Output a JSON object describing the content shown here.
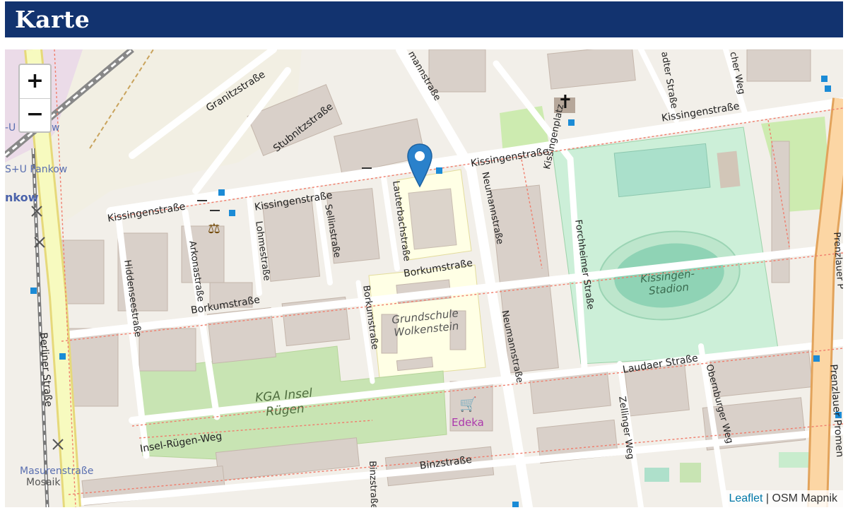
{
  "header": {
    "title": "Karte"
  },
  "map": {
    "zoom_in_label": "+",
    "zoom_out_label": "−",
    "attribution": {
      "link": "Leaflet",
      "separator": " | ",
      "provider": "OSM Mapnik"
    },
    "marker_icon": "map-marker-icon",
    "streets": {
      "granitzstrasse": "Granitzstraße",
      "stubnitzstrasse": "Stubnitzstraße",
      "kissingen_1": "Kissingenstraße",
      "kissingen_2": "Kissingenstraße",
      "kissingen_3": "Kissingenstraße",
      "kissingen_4": "Kissingenstraße",
      "kissingenplatz": "Kissingenplatz",
      "sellinstrasse": "Sellinstraße",
      "lauterbachstrasse": "Lauterbachstraße",
      "lohmestrasse": "Lohmestraße",
      "arkonastrasse": "Arkonastraße",
      "hiddenseestrasse": "Hiddenseestraße",
      "borkum_1": "Borkumstraße",
      "borkum_2": "Borkumstraße",
      "borkum_3": "Borkumstraße",
      "neumann_1": "Neumannstraße",
      "neumann_2": "Neumannstraße",
      "neumann_top": "mannstraße",
      "forchheimer": "Forchheimer Straße",
      "laudaer": "Laudaer Straße",
      "zellinger": "Zellinger Weg",
      "obernburger": "Obernburger Weg",
      "binzstrasse": "Binzstraße",
      "binz_vertical": "Binzstraße",
      "insel_ruegen_weg": "Insel-Rügen-Weg",
      "berliner": "Berliner Straße",
      "masuren": "Masurenstraße",
      "mosaik": "Mosaik",
      "prenzlauer": "Prenzlauer Promen",
      "prenzlauer_b": "Prenzlauer P",
      "aschaffenburger": "adter Straße",
      "cher_weg": "cher Weg",
      "u_bahn_top": "-U",
      "u_bahn_w": "w",
      "s_u_pankow": "S+U Pankow",
      "pankow": "nkow"
    },
    "pois": {
      "grundschule_1": "Grundschule",
      "grundschule_2": "Wolkenstein",
      "stadion_1": "Kissingen-",
      "stadion_2": "Stadion",
      "kga_1": "KGA Insel",
      "kga_2": "Rügen",
      "edeka": "Edeka"
    },
    "icons": {
      "court": "scales-icon",
      "church": "cross-icon",
      "shop": "shopping-cart-icon"
    }
  }
}
